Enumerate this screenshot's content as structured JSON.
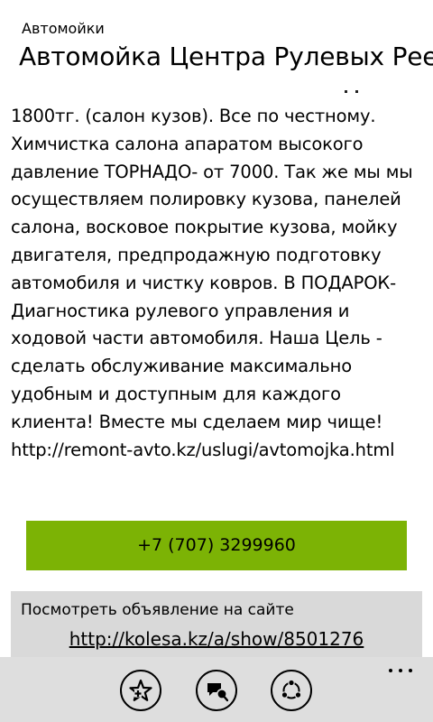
{
  "header": {
    "subtitle": "Автомойки",
    "title": "Автомойка Центра Рулевых Реек"
  },
  "listing": {
    "description": "1800тг. (салон кузов). Все по честному. Химчистка салона апаратом высокого давление ТОРНАДО- от 7000. Так же мы мы осуществляем полировку кузова, панелей салона, восковое покрытие кузова, мойку двигателя, предпродажную подготовку автомобиля и чистку ковров. В ПОДАРОК-Диагностика рулевого управления и ходовой части автомобиля. Наша Цель - сделать обслуживание максимально удобным и доступным для каждого клиента! Вместе мы сделаем мир чище! http://remont-avto.kz/uslugi/avtomojka.html",
    "phone": "+7 (707) 3299960"
  },
  "site_panel": {
    "label": "Посмотреть объявление на сайте",
    "url": "http://kolesa.kz/a/show/8501276"
  },
  "app_bar": {
    "buttons": [
      {
        "icon": "favorite-star-icon"
      },
      {
        "icon": "message-icon"
      },
      {
        "icon": "share-icon"
      }
    ],
    "more_icon": "more-icon"
  },
  "colors": {
    "accent": "#7cb305",
    "panel": "#d9d9d9",
    "app_bar": "#dedede",
    "background": "#ffffff",
    "text": "#000000"
  }
}
